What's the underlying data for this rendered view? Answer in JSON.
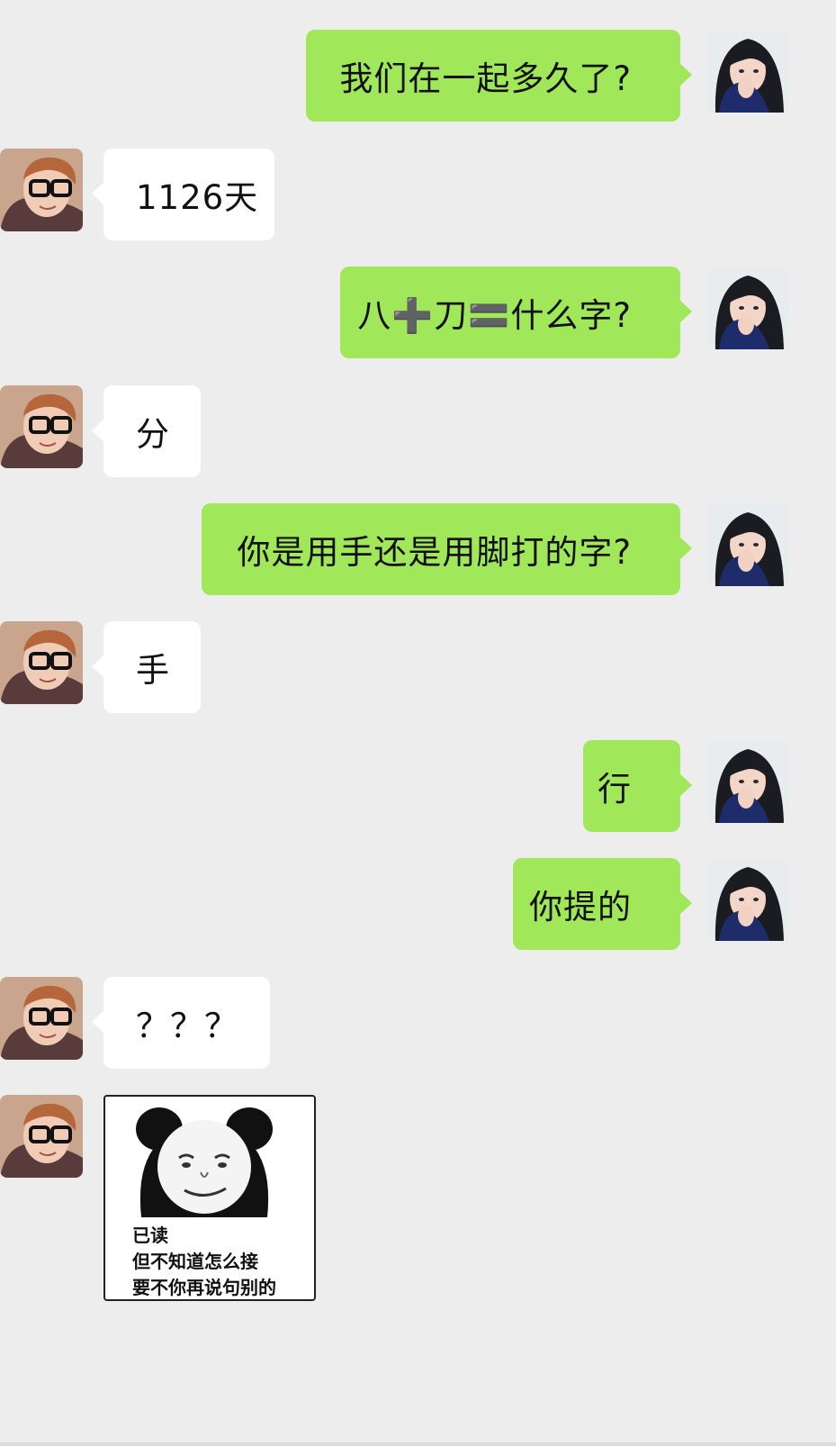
{
  "messages": [
    {
      "side": "right",
      "text": "我们在一起多久了?"
    },
    {
      "side": "left",
      "text": "1126天"
    },
    {
      "side": "right",
      "text": "八➕刀🟰什么字?"
    },
    {
      "side": "left",
      "text": "分"
    },
    {
      "side": "right",
      "text": "你是用手还是用脚打的字?"
    },
    {
      "side": "left",
      "text": "手"
    },
    {
      "side": "right",
      "text": "行"
    },
    {
      "side": "right",
      "text": "你提的"
    },
    {
      "side": "left",
      "text": "？？？"
    }
  ],
  "sticker": {
    "lines": [
      "已读",
      "但不知道怎么接",
      "要不你再说句别的"
    ]
  },
  "colors": {
    "background": "#ededed",
    "sent_bubble": "#a0e75a",
    "received_bubble": "#ffffff"
  },
  "icons": {
    "sender_avatar": "girl-avatar-icon",
    "receiver_avatar": "boy-glasses-avatar-icon",
    "sticker": "panda-face-meme-icon"
  }
}
